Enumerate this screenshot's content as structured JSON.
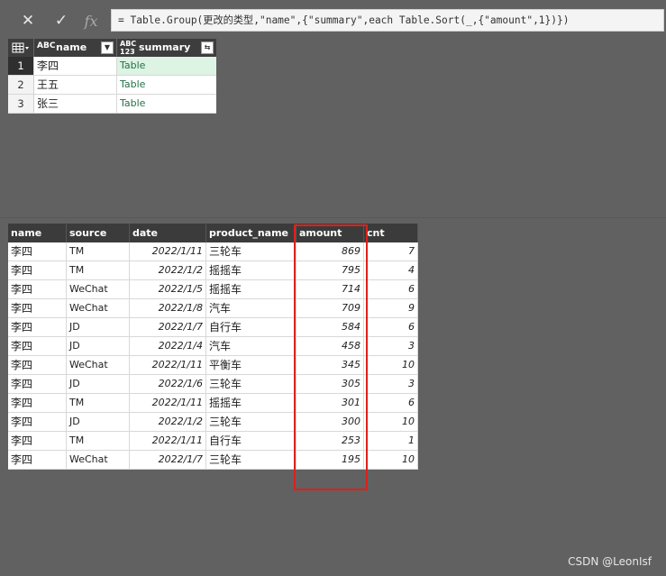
{
  "formula_bar": {
    "cancel_icon": "close-icon",
    "commit_icon": "check-icon",
    "fx_label": "fx",
    "formula": "= Table.Group(更改的类型,\"name\",{\"summary\",each Table.Sort(_,{\"amount\",1})})"
  },
  "top_table": {
    "columns": [
      {
        "type_icon": "ABC",
        "label": "name"
      },
      {
        "type_icon": "ABC 123",
        "label": "summary"
      }
    ],
    "rows": [
      {
        "index": "1",
        "name": "李四",
        "summary": "Table"
      },
      {
        "index": "2",
        "name": "王五",
        "summary": "Table"
      },
      {
        "index": "3",
        "name": "张三",
        "summary": "Table"
      }
    ]
  },
  "detail_table": {
    "columns": [
      "name",
      "source",
      "date",
      "product_name",
      "amount",
      "cnt"
    ],
    "rows": [
      [
        "李四",
        "TM",
        "2022/1/11",
        "三轮车",
        "869",
        "7"
      ],
      [
        "李四",
        "TM",
        "2022/1/2",
        "摇摇车",
        "795",
        "4"
      ],
      [
        "李四",
        "WeChat",
        "2022/1/5",
        "摇摇车",
        "714",
        "6"
      ],
      [
        "李四",
        "WeChat",
        "2022/1/8",
        "汽车",
        "709",
        "9"
      ],
      [
        "李四",
        "JD",
        "2022/1/7",
        "自行车",
        "584",
        "6"
      ],
      [
        "李四",
        "JD",
        "2022/1/4",
        "汽车",
        "458",
        "3"
      ],
      [
        "李四",
        "WeChat",
        "2022/1/11",
        "平衡车",
        "345",
        "10"
      ],
      [
        "李四",
        "JD",
        "2022/1/6",
        "三轮车",
        "305",
        "3"
      ],
      [
        "李四",
        "TM",
        "2022/1/11",
        "摇摇车",
        "301",
        "6"
      ],
      [
        "李四",
        "JD",
        "2022/1/2",
        "三轮车",
        "300",
        "10"
      ],
      [
        "李四",
        "TM",
        "2022/1/11",
        "自行车",
        "253",
        "1"
      ],
      [
        "李四",
        "WeChat",
        "2022/1/7",
        "三轮车",
        "195",
        "10"
      ]
    ]
  },
  "highlight_color": "#e0201a",
  "watermark": "CSDN @LeonIsf"
}
